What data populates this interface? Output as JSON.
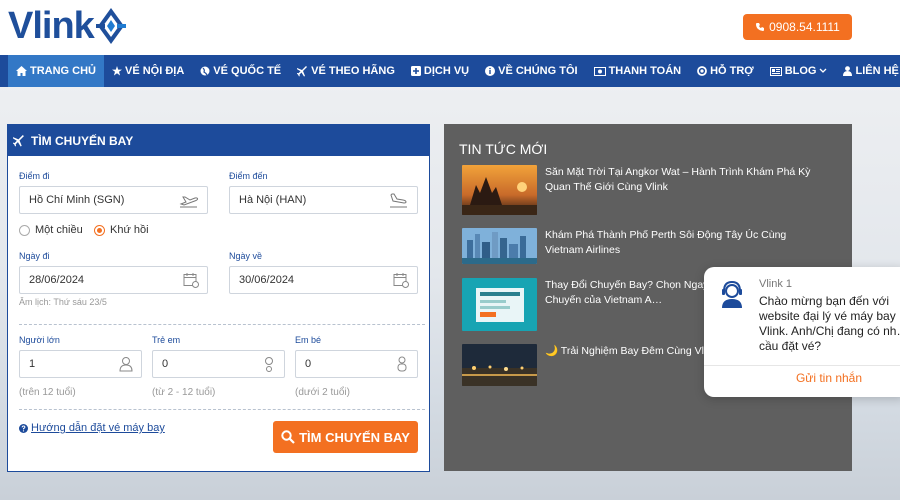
{
  "header": {
    "logo_text": "Vlink",
    "hotline": "0908.54.1111",
    "brand_color": "#1d4b9b",
    "accent_color": "#f37021"
  },
  "nav": {
    "items": [
      {
        "label": "TRANG CHỦ",
        "icon": "home-icon",
        "active": true
      },
      {
        "label": "VÉ NỘI ĐỊA",
        "icon": "star-icon"
      },
      {
        "label": "VÉ QUỐC TẾ",
        "icon": "globe-icon"
      },
      {
        "label": "VÉ THEO HÃNG",
        "icon": "plane-icon"
      },
      {
        "label": "DỊCH VỤ",
        "icon": "plus-square-icon"
      },
      {
        "label": "VỀ CHÚNG TÔI",
        "icon": "info-icon"
      },
      {
        "label": "THANH TOÁN",
        "icon": "money-icon"
      },
      {
        "label": "HỖ TRỢ",
        "icon": "lifebuoy-icon"
      },
      {
        "label": "BLOG",
        "icon": "newspaper-icon",
        "has_dropdown": true
      },
      {
        "label": "LIÊN HỆ",
        "icon": "user-icon"
      }
    ]
  },
  "search": {
    "title": "TÌM CHUYẾN BAY",
    "from_label": "Điểm đi",
    "from_value": "Hồ Chí Minh (SGN)",
    "to_label": "Điểm đến",
    "to_value": "Hà Nội (HAN)",
    "trip_oneway": "Một chiều",
    "trip_round": "Khứ hồi",
    "selected_trip": "Khứ hồi",
    "depart_label": "Ngày đi",
    "depart_value": "28/06/2024",
    "return_label": "Ngày về",
    "return_value": "30/06/2024",
    "lunar_note": "Âm lịch: Thứ sáu 23/5",
    "adult_label": "Người lớn",
    "adult_value": "1",
    "adult_note": "(trên 12 tuổi)",
    "child_label": "Trẻ em",
    "child_value": "0",
    "child_note": "(từ 2 - 12 tuổi)",
    "infant_label": "Em bé",
    "infant_value": "0",
    "infant_note": "(dưới 2 tuổi)",
    "guide_link": "Hướng dẫn đặt vé máy bay",
    "submit": "TÌM CHUYẾN BAY"
  },
  "news": {
    "title": "TIN TỨC MỚI",
    "items": [
      {
        "text": "Săn Mặt Trời Tại Angkor Wat – Hành Trình Khám Phá Kỳ Quan Thế Giới Cùng Vlink"
      },
      {
        "text": "Khám Phá Thành Phố Perth Sôi Động Tây Úc Cùng Vietnam Airlines"
      },
      {
        "text": "Thay Đổi Chuyến Bay? Chọn Ngay C… Năng Tự Đổi Chuyến của Vietnam A…"
      },
      {
        "text": "🌙 Trải Nghiệm Bay Đêm Cùng Vlin…"
      }
    ]
  },
  "chat": {
    "name": "Vlink 1",
    "message": "Chào mừng bạn đến với website đại lý vé máy bay Vlink. Anh/Chị đang có nh… cầu đặt vé?",
    "button": "Gửi tin nhắn"
  }
}
